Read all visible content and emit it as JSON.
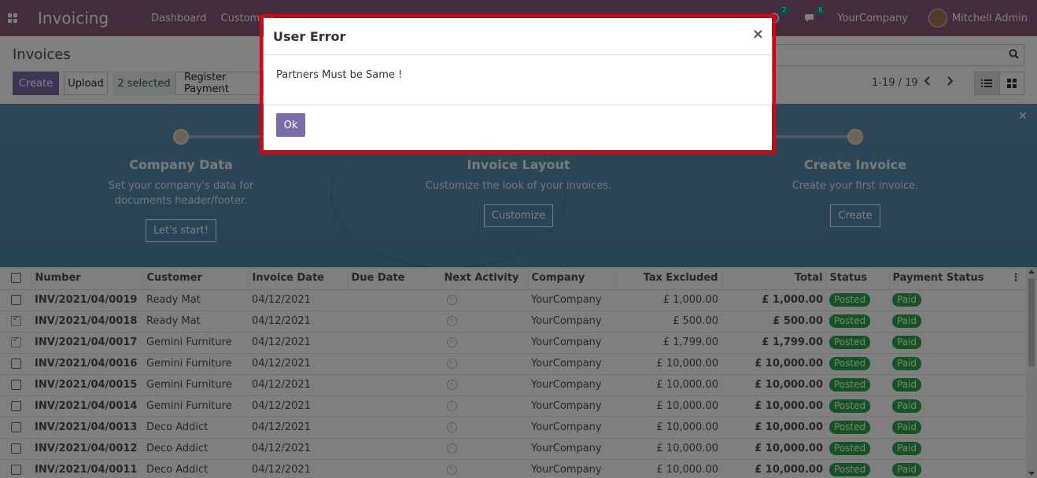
{
  "navbar": {
    "app_name": "Invoicing",
    "menu": [
      "Dashboard",
      "Customers"
    ],
    "activity_count": "2",
    "message_count": "6",
    "company": "YourCompany",
    "user": "Mitchell Admin"
  },
  "control_panel": {
    "title": "Invoices",
    "create_label": "Create",
    "upload_label": "Upload",
    "selected_label": "2 selected",
    "register_label": "Register Payment",
    "pager": "1-19 / 19"
  },
  "banner": {
    "steps": [
      {
        "title": "Company Data",
        "desc_line1": "Set your company's data for",
        "desc_line2": "documents header/footer.",
        "button": "Let's start!"
      },
      {
        "title": "Invoice Layout",
        "desc_line1": "Customize the look of your invoices.",
        "desc_line2": "",
        "button": "Customize"
      },
      {
        "title": "Create Invoice",
        "desc_line1": "Create your first invoice.",
        "desc_line2": "",
        "button": "Create"
      }
    ]
  },
  "table": {
    "headers": [
      "Number",
      "Customer",
      "Invoice Date",
      "Due Date",
      "Next Activity",
      "Company",
      "Tax Excluded",
      "Total",
      "Status",
      "Payment Status"
    ],
    "rows": [
      {
        "number": "INV/2021/04/0019",
        "customer": "Ready Mat",
        "date": "04/12/2021",
        "company": "YourCompany",
        "tax_excluded": "£ 1,000.00",
        "total": "£ 1,000.00",
        "status": "Posted",
        "payment": "Paid",
        "checked": false
      },
      {
        "number": "INV/2021/04/0018",
        "customer": "Ready Mat",
        "date": "04/12/2021",
        "company": "YourCompany",
        "tax_excluded": "£ 500.00",
        "total": "£ 500.00",
        "status": "Posted",
        "payment": "Paid",
        "checked": true
      },
      {
        "number": "INV/2021/04/0017",
        "customer": "Gemini Furniture",
        "date": "04/12/2021",
        "company": "YourCompany",
        "tax_excluded": "£ 1,799.00",
        "total": "£ 1,799.00",
        "status": "Posted",
        "payment": "Paid",
        "checked": true
      },
      {
        "number": "INV/2021/04/0016",
        "customer": "Gemini Furniture",
        "date": "04/12/2021",
        "company": "YourCompany",
        "tax_excluded": "£ 10,000.00",
        "total": "£ 10,000.00",
        "status": "Posted",
        "payment": "Paid",
        "checked": false
      },
      {
        "number": "INV/2021/04/0015",
        "customer": "Gemini Furniture",
        "date": "04/12/2021",
        "company": "YourCompany",
        "tax_excluded": "£ 10,000.00",
        "total": "£ 10,000.00",
        "status": "Posted",
        "payment": "Paid",
        "checked": false
      },
      {
        "number": "INV/2021/04/0014",
        "customer": "Gemini Furniture",
        "date": "04/12/2021",
        "company": "YourCompany",
        "tax_excluded": "£ 10,000.00",
        "total": "£ 10,000.00",
        "status": "Posted",
        "payment": "Paid",
        "checked": false
      },
      {
        "number": "INV/2021/04/0013",
        "customer": "Deco Addict",
        "date": "04/12/2021",
        "company": "YourCompany",
        "tax_excluded": "£ 10,000.00",
        "total": "£ 10,000.00",
        "status": "Posted",
        "payment": "Paid",
        "checked": false
      },
      {
        "number": "INV/2021/04/0012",
        "customer": "Deco Addict",
        "date": "04/12/2021",
        "company": "YourCompany",
        "tax_excluded": "£ 10,000.00",
        "total": "£ 10,000.00",
        "status": "Posted",
        "payment": "Paid",
        "checked": false
      },
      {
        "number": "INV/2021/04/0011",
        "customer": "Deco Addict",
        "date": "04/12/2021",
        "company": "YourCompany",
        "tax_excluded": "£ 10,000.00",
        "total": "£ 10,000.00",
        "status": "Posted",
        "payment": "Paid",
        "checked": false
      }
    ]
  },
  "dialog": {
    "title": "User Error",
    "message": "Partners Must be Same !",
    "ok_label": "Ok",
    "close_symbol": "×"
  },
  "colors": {
    "navbar": "#875a7b",
    "primary_button": "#7c6ba9",
    "status_badge": "#28a745",
    "highlight_border": "#e0000d"
  }
}
